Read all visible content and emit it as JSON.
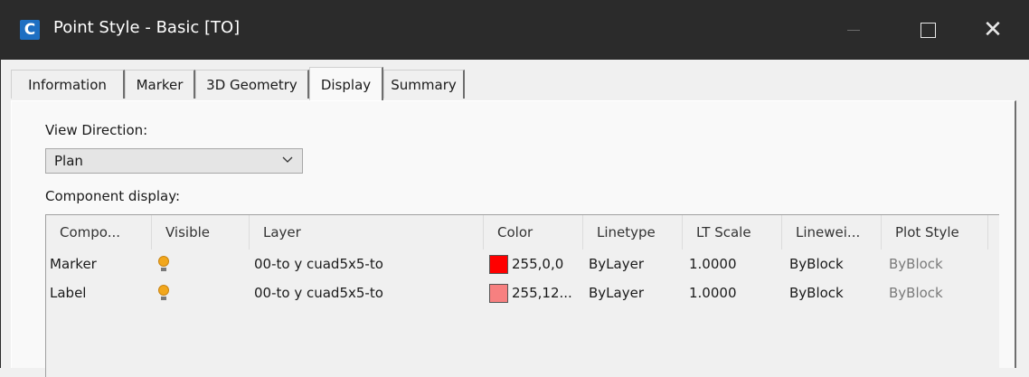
{
  "window": {
    "title": "Point Style - Basic [TO]",
    "app_icon_letter": "C",
    "minimize_icon": "minimize-icon",
    "maximize_icon": "maximize-icon",
    "close_glyph": "✕"
  },
  "tabs": [
    {
      "label": "Information",
      "active": false
    },
    {
      "label": "Marker",
      "active": false
    },
    {
      "label": "3D Geometry",
      "active": false
    },
    {
      "label": "Display",
      "active": true
    },
    {
      "label": "Summary",
      "active": false
    }
  ],
  "display": {
    "view_direction_label": "View Direction:",
    "view_direction_value": "Plan",
    "component_display_label": "Component display:"
  },
  "table": {
    "columns": [
      "Compo...",
      "Visible",
      "Layer",
      "Color",
      "Linetype",
      "LT Scale",
      "Linewei...",
      "Plot Style"
    ],
    "rows": [
      {
        "component": "Marker",
        "visible": true,
        "layer": "00-to y cuad5x5-to",
        "color_text": "255,0,0",
        "color_hex": "#ff0000",
        "linetype": "ByLayer",
        "lt_scale": "1.0000",
        "lineweight": "ByBlock",
        "plot_style": "ByBlock"
      },
      {
        "component": "Label",
        "visible": true,
        "layer": "00-to y cuad5x5-to",
        "color_text": "255,12...",
        "color_hex": "#f78080",
        "linetype": "ByLayer",
        "lt_scale": "1.0000",
        "lineweight": "ByBlock",
        "plot_style": "ByBlock"
      }
    ]
  }
}
